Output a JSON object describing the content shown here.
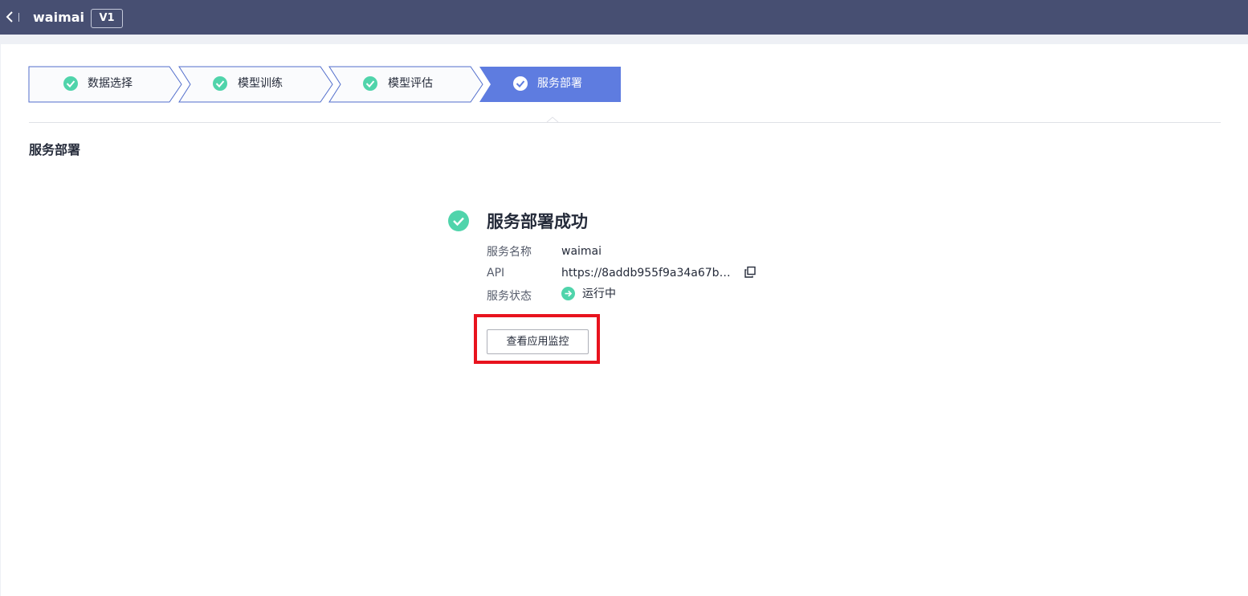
{
  "header": {
    "app_name": "waimai",
    "version": "V1",
    "back_icon": "chevron-left-icon"
  },
  "steps": [
    {
      "label": "数据选择",
      "status": "done"
    },
    {
      "label": "模型训练",
      "status": "done"
    },
    {
      "label": "模型评估",
      "status": "done"
    },
    {
      "label": "服务部署",
      "status": "active"
    }
  ],
  "section_title": "服务部署",
  "result": {
    "title": "服务部署成功",
    "icon": "success-check-icon",
    "service_name_label": "服务名称",
    "service_name_value": "waimai",
    "api_label": "API",
    "api_value": "https://8addb955f9a34a67bb...",
    "status_label": "服务状态",
    "status_value": "运行中",
    "status_icon": "arrow-right-circle-icon",
    "copy_icon": "copy-icon",
    "monitor_button": "查看应用监控"
  },
  "colors": {
    "topbar": "#474f72",
    "success": "#50d4ab",
    "step_active": "#5e7ce0",
    "step_border": "#526ecc",
    "highlight": "#e8131e"
  }
}
